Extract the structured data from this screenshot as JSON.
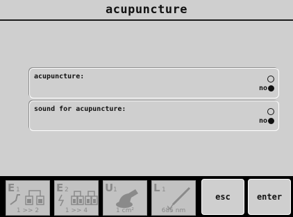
{
  "header": {
    "title": "acupuncture"
  },
  "options": [
    {
      "label": "acupuncture:",
      "value": "no"
    },
    {
      "label": "sound for acupuncture:",
      "value": "no"
    }
  ],
  "footer": {
    "tiles": [
      {
        "letter": "E",
        "sub": "1",
        "bottom": "1 >> 2",
        "icon": "electrodes-pair-icon"
      },
      {
        "letter": "E",
        "sub": "2",
        "bottom": "1 >> 4",
        "icon": "electrodes-quad-icon"
      },
      {
        "letter": "U",
        "sub": "1",
        "bottom": "1 cm²",
        "icon": "ultrasound-head-icon"
      },
      {
        "letter": "L",
        "sub": "1",
        "bottom": "685 nm",
        "icon": "laser-pen-icon"
      }
    ],
    "esc_label": "esc",
    "enter_label": "enter"
  },
  "colors": {
    "screen_bg": "#cfcfcf",
    "text": "#111111",
    "disabled": "#8a8a8a",
    "footer_bg": "#000000"
  }
}
